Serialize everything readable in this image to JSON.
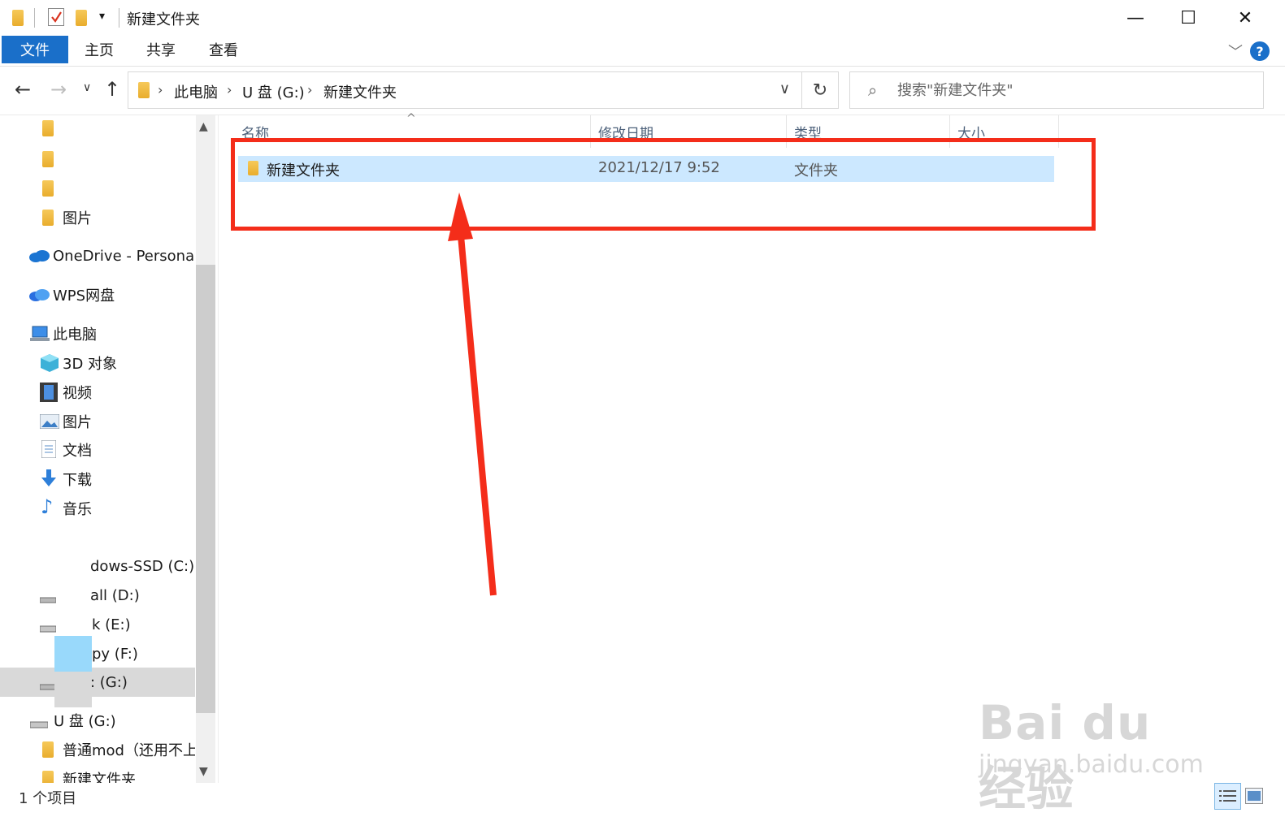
{
  "window": {
    "title": "新建文件夹",
    "minimize_glyph": "—",
    "maximize_glyph": "☐",
    "close_glyph": "✕"
  },
  "ribbon": {
    "tabs": [
      {
        "label": "文件",
        "active": true
      },
      {
        "label": "主页"
      },
      {
        "label": "共享"
      },
      {
        "label": "查看"
      }
    ],
    "help_glyph": "?"
  },
  "address": {
    "breadcrumbs": [
      "此电脑",
      "U 盘 (G:)",
      "新建文件夹"
    ],
    "search_placeholder": "搜索\"新建文件夹\""
  },
  "nav_pane": {
    "items": [
      {
        "label": "图片",
        "icon": "folder-icon"
      },
      {
        "label": "OneDrive - Personal",
        "icon": "onedrive-cloud-icon"
      },
      {
        "label": "WPS网盘",
        "icon": "wps-cloud-icon"
      },
      {
        "label": "此电脑",
        "icon": "computer-icon"
      },
      {
        "label": "3D 对象",
        "icon": "3d-objects-icon"
      },
      {
        "label": "视频",
        "icon": "video-icon"
      },
      {
        "label": "图片",
        "icon": "pictures-icon"
      },
      {
        "label": "文档",
        "icon": "documents-icon"
      },
      {
        "label": "下载",
        "icon": "download-icon"
      },
      {
        "label": "音乐",
        "icon": "music-icon"
      },
      {
        "label": "dows-SSD (C:)",
        "icon": "drive-icon"
      },
      {
        "label": "all (D:)",
        "icon": "drive-icon"
      },
      {
        "label": "k (E:)",
        "icon": "drive-icon"
      },
      {
        "label": "py (F:)",
        "icon": "drive-icon"
      },
      {
        "label": ": (G:)",
        "icon": "drive-icon",
        "selected": true
      },
      {
        "label": "U 盘 (G:)",
        "icon": "usb-drive-icon"
      },
      {
        "label": "普通mod（还用不上",
        "icon": "folder-icon"
      },
      {
        "label": "新建文件夹",
        "icon": "folder-icon"
      }
    ]
  },
  "file_list": {
    "columns": [
      "名称",
      "修改日期",
      "类型",
      "大小"
    ],
    "rows": [
      {
        "name": "新建文件夹",
        "modified": "2021/12/17 9:52",
        "type": "文件夹",
        "size": ""
      }
    ]
  },
  "status_bar": {
    "item_count": "1 个项目"
  },
  "watermark": {
    "logo": "Bai du 经验",
    "url": "jingyan.baidu.com"
  },
  "colors": {
    "accent": "#1a6fc9",
    "selection": "#cce8ff",
    "annotation_red": "#f42d1a"
  }
}
